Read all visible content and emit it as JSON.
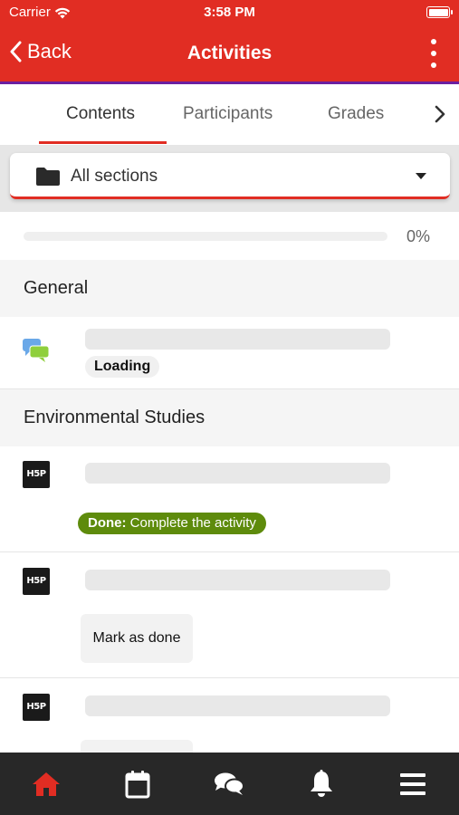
{
  "status_bar": {
    "carrier": "Carrier",
    "time": "3:58 PM"
  },
  "header": {
    "back_label": "Back",
    "title": "Activities",
    "more_icon": "more-vertical-icon"
  },
  "colors": {
    "brand": "#e12d23",
    "accent_line": "#6b1fa0",
    "done_badge": "#5e8b0c",
    "nav_active": "#e12d23",
    "nav_bg": "#282828"
  },
  "tabs": [
    {
      "label": "Contents",
      "active": true
    },
    {
      "label": "Participants",
      "active": false
    },
    {
      "label": "Grades",
      "active": false
    }
  ],
  "section_selector": {
    "label": "All sections",
    "icon": "folder-icon"
  },
  "progress": {
    "value": 0,
    "label": "0%"
  },
  "sections": [
    {
      "name": "General",
      "activities": [
        {
          "icon": "forum-icon",
          "badge": "Loading"
        }
      ]
    },
    {
      "name": "Environmental Studies",
      "activities": [
        {
          "icon": "h5p-icon",
          "icon_text": "H5P",
          "status_label": "Done:",
          "status_text": "Complete the activity"
        },
        {
          "icon": "h5p-icon",
          "icon_text": "H5P",
          "button_label": "Mark as done"
        },
        {
          "icon": "h5p-icon",
          "icon_text": "H5P"
        }
      ]
    }
  ],
  "bottom_nav": [
    {
      "icon": "home-icon",
      "active": true
    },
    {
      "icon": "calendar-icon",
      "active": false
    },
    {
      "icon": "messages-icon",
      "active": false
    },
    {
      "icon": "bell-icon",
      "active": false
    },
    {
      "icon": "menu-icon",
      "active": false
    }
  ]
}
